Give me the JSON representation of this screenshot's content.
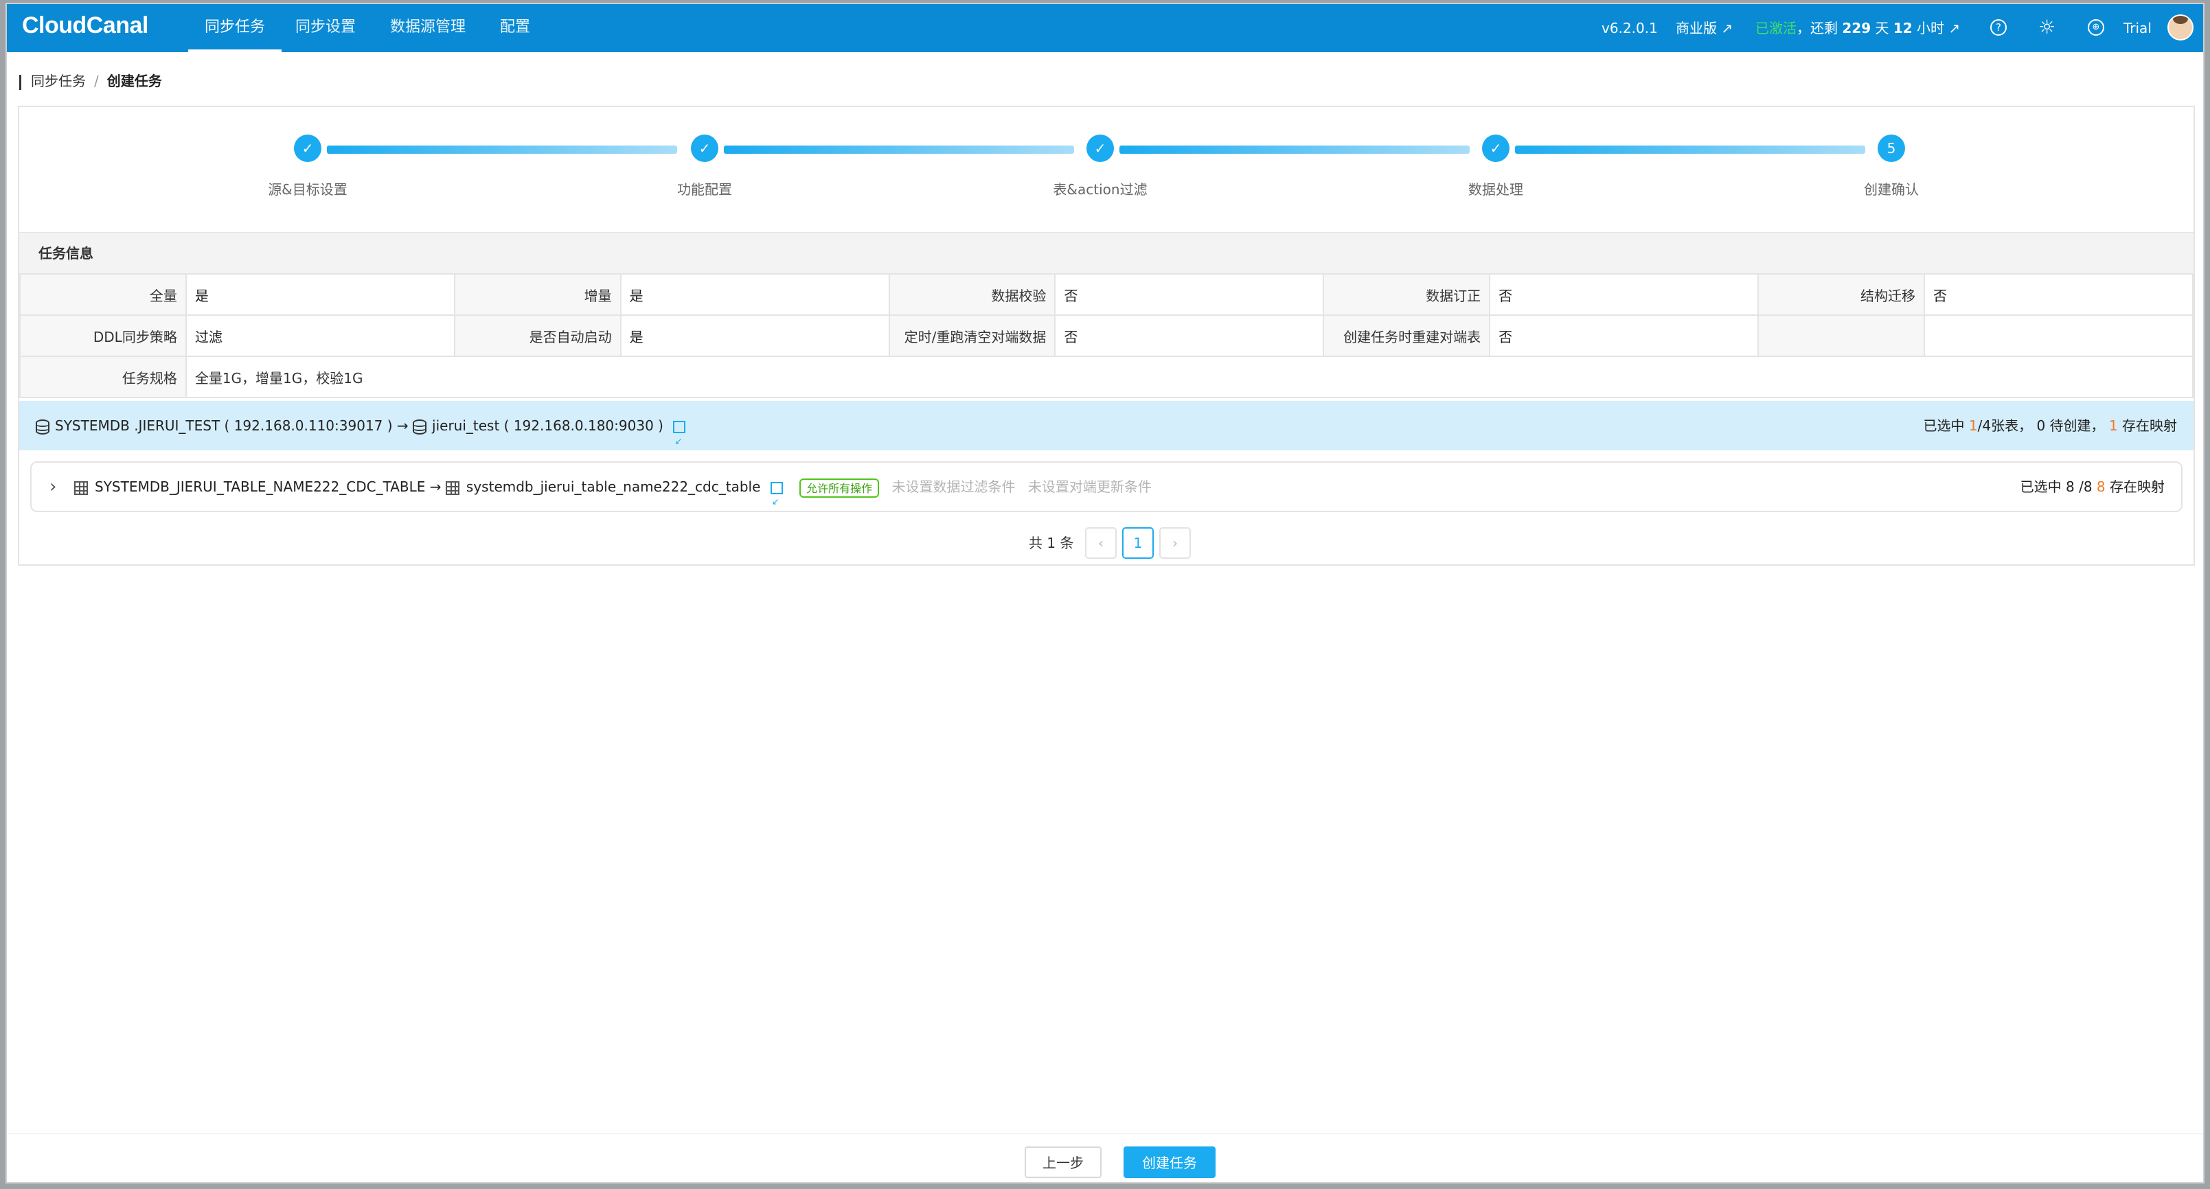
{
  "nav": {
    "logo": "CloudCanal",
    "items": [
      "同步任务",
      "同步设置",
      "数据源管理",
      "配置"
    ],
    "version": "v6.2.0.1",
    "edition": "商业版 ↗",
    "activated": "已激活",
    "remaining_prefix": "，还剩",
    "remaining_days": "229",
    "days_unit": "天",
    "remaining_hours": "12",
    "hours_unit": "小时 ↗",
    "help_icon": "question-circle-icon",
    "theme_icon": "sun-icon",
    "lang_icon": "globe-icon",
    "user": "Trial"
  },
  "breadcrumb": {
    "parent": "同步任务",
    "separator": "/",
    "current": "创建任务"
  },
  "steps": [
    {
      "label": "源&目标设置",
      "marker": "✓",
      "done": true
    },
    {
      "label": "功能配置",
      "marker": "✓",
      "done": true
    },
    {
      "label": "表&action过滤",
      "marker": "✓",
      "done": true
    },
    {
      "label": "数据处理",
      "marker": "✓",
      "done": true
    },
    {
      "label": "创建确认",
      "marker": "5",
      "done": false
    }
  ],
  "task_info": {
    "title": "任务信息",
    "row1": [
      {
        "k": "全量",
        "v": "是"
      },
      {
        "k": "增量",
        "v": "是"
      },
      {
        "k": "数据校验",
        "v": "否"
      },
      {
        "k": "数据订正",
        "v": "否"
      },
      {
        "k": "结构迁移",
        "v": "否"
      }
    ],
    "row2": [
      {
        "k": "DDL同步策略",
        "v": "过滤"
      },
      {
        "k": "是否自动启动",
        "v": "是"
      },
      {
        "k": "定时/重跑清空对端数据",
        "v": "否"
      },
      {
        "k": "创建任务时重建对端表",
        "v": "否"
      }
    ],
    "row3": {
      "k": "任务规格",
      "v": "全量1G，增量1G，校验1G"
    }
  },
  "mapping": {
    "source_db": "SYSTEMDB .JIERUI_TEST",
    "source_addr": "( 192.168.0.110:39017 )",
    "arrow": "→",
    "target_db": "jierui_test",
    "target_addr": "( 192.168.0.180:9030 )",
    "stat_prefix": "已选中",
    "selected": "1",
    "total_tables": "/4张表，",
    "pending": "0 待创建，",
    "mapped": "1",
    "mapped_suffix": "存在映射"
  },
  "table_row": {
    "expand": "›",
    "source_table": "SYSTEMDB_JIERUI_TABLE_NAME222_CDC_TABLE",
    "arrow": "→",
    "target_table": "systemdb_jierui_table_name222_cdc_table",
    "tag": "允许所有操作",
    "filter_hint": "未设置数据过滤条件",
    "update_hint": "未设置对端更新条件",
    "stat_prefix": "已选中 8 /8",
    "stat_mapped": "8",
    "stat_suffix": "存在映射"
  },
  "pager": {
    "total": "共 1 条",
    "prev": "‹",
    "page": "1",
    "next": "›"
  },
  "footer": {
    "prev_label": "上一步",
    "create_label": "创建任务"
  },
  "colors": {
    "nav": "#0a8ad4",
    "accent": "#1aabf0",
    "highlight": "#d5eefb",
    "orange": "#f07a25",
    "green": "#52c41a"
  }
}
